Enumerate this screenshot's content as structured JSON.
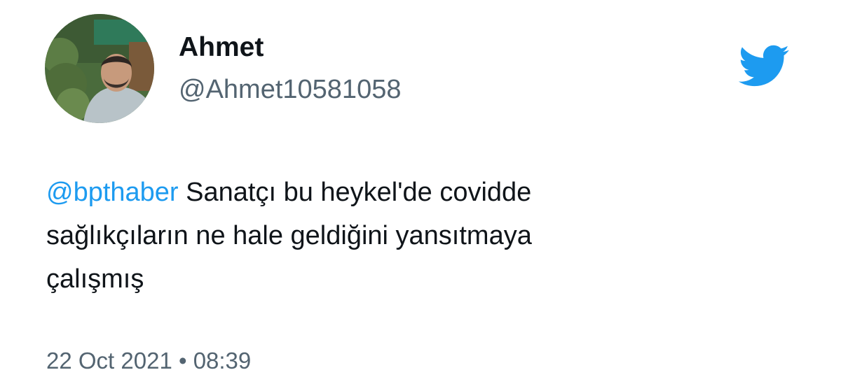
{
  "author": {
    "display_name": "Ahmet",
    "handle": "@Ahmet10581058",
    "avatar": "profile-photo-avatar"
  },
  "tweet": {
    "mention": "@bpthaber",
    "line1_rest": " Sanatçı bu heykel'de covidde",
    "line2": "sağlıkçıların ne hale geldiğini yansıtmaya",
    "line3": "çalışmış"
  },
  "meta": {
    "date": "22 Oct 2021",
    "separator": " • ",
    "time": "08:39"
  },
  "icons": {
    "logo": "twitter-bird-icon"
  },
  "colors": {
    "brand": "#1d9bf0",
    "text": "#0f1419",
    "secondary": "#536471"
  }
}
